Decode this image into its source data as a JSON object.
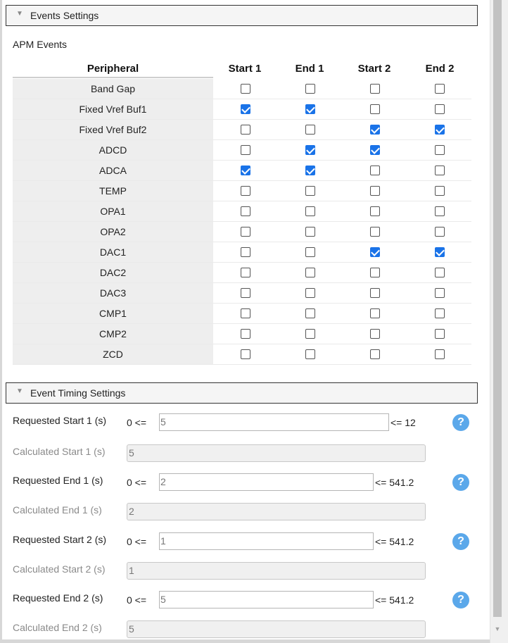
{
  "events_section": {
    "title": "Events Settings",
    "subtitle": "APM Events",
    "columns": [
      "Peripheral",
      "Start 1",
      "End 1",
      "Start 2",
      "End 2"
    ],
    "rows": [
      {
        "name": "Band Gap",
        "checks": [
          false,
          false,
          false,
          false
        ]
      },
      {
        "name": "Fixed Vref Buf1",
        "checks": [
          true,
          true,
          false,
          false
        ]
      },
      {
        "name": "Fixed Vref Buf2",
        "checks": [
          false,
          false,
          true,
          true
        ]
      },
      {
        "name": "ADCD",
        "checks": [
          false,
          true,
          true,
          false
        ]
      },
      {
        "name": "ADCA",
        "checks": [
          true,
          true,
          false,
          false
        ]
      },
      {
        "name": "TEMP",
        "checks": [
          false,
          false,
          false,
          false
        ]
      },
      {
        "name": "OPA1",
        "checks": [
          false,
          false,
          false,
          false
        ]
      },
      {
        "name": "OPA2",
        "checks": [
          false,
          false,
          false,
          false
        ]
      },
      {
        "name": "DAC1",
        "checks": [
          false,
          false,
          true,
          true
        ]
      },
      {
        "name": "DAC2",
        "checks": [
          false,
          false,
          false,
          false
        ]
      },
      {
        "name": "DAC3",
        "checks": [
          false,
          false,
          false,
          false
        ]
      },
      {
        "name": "CMP1",
        "checks": [
          false,
          false,
          false,
          false
        ]
      },
      {
        "name": "CMP2",
        "checks": [
          false,
          false,
          false,
          false
        ]
      },
      {
        "name": "ZCD",
        "checks": [
          false,
          false,
          false,
          false
        ]
      }
    ]
  },
  "timing_section": {
    "title": "Event Timing Settings",
    "fields": [
      {
        "label": "Requested Start 1 (s)",
        "prefix": "0 <=",
        "value": "5",
        "suffix": "<= 12",
        "kind": "requested"
      },
      {
        "label": "Calculated Start 1 (s)",
        "value": "5",
        "kind": "calculated"
      },
      {
        "label": "Requested End 1 (s)",
        "prefix": "0 <=",
        "value": "2",
        "suffix": "<= 541.2",
        "kind": "requested"
      },
      {
        "label": "Calculated End 1 (s)",
        "value": "2",
        "kind": "calculated"
      },
      {
        "label": "Requested Start 2 (s)",
        "prefix": "0 <=",
        "value": "1",
        "suffix": "<= 541.2",
        "kind": "requested"
      },
      {
        "label": "Calculated Start 2 (s)",
        "value": "1",
        "kind": "calculated"
      },
      {
        "label": "Requested End 2 (s)",
        "prefix": "0 <=",
        "value": "5",
        "suffix": "<= 541.2",
        "kind": "requested"
      },
      {
        "label": "Calculated End 2 (s)",
        "value": "5",
        "kind": "calculated"
      }
    ]
  },
  "icons": {
    "collapse": "collapse-triangle-icon",
    "help": "help-question-icon",
    "help_glyph": "?",
    "scroll_down": "scroll-down-arrow-icon"
  },
  "colors": {
    "checkbox_checked": "#1a73e8",
    "help_icon": "#5ba8ea",
    "label_bg": "#eeeeee"
  }
}
